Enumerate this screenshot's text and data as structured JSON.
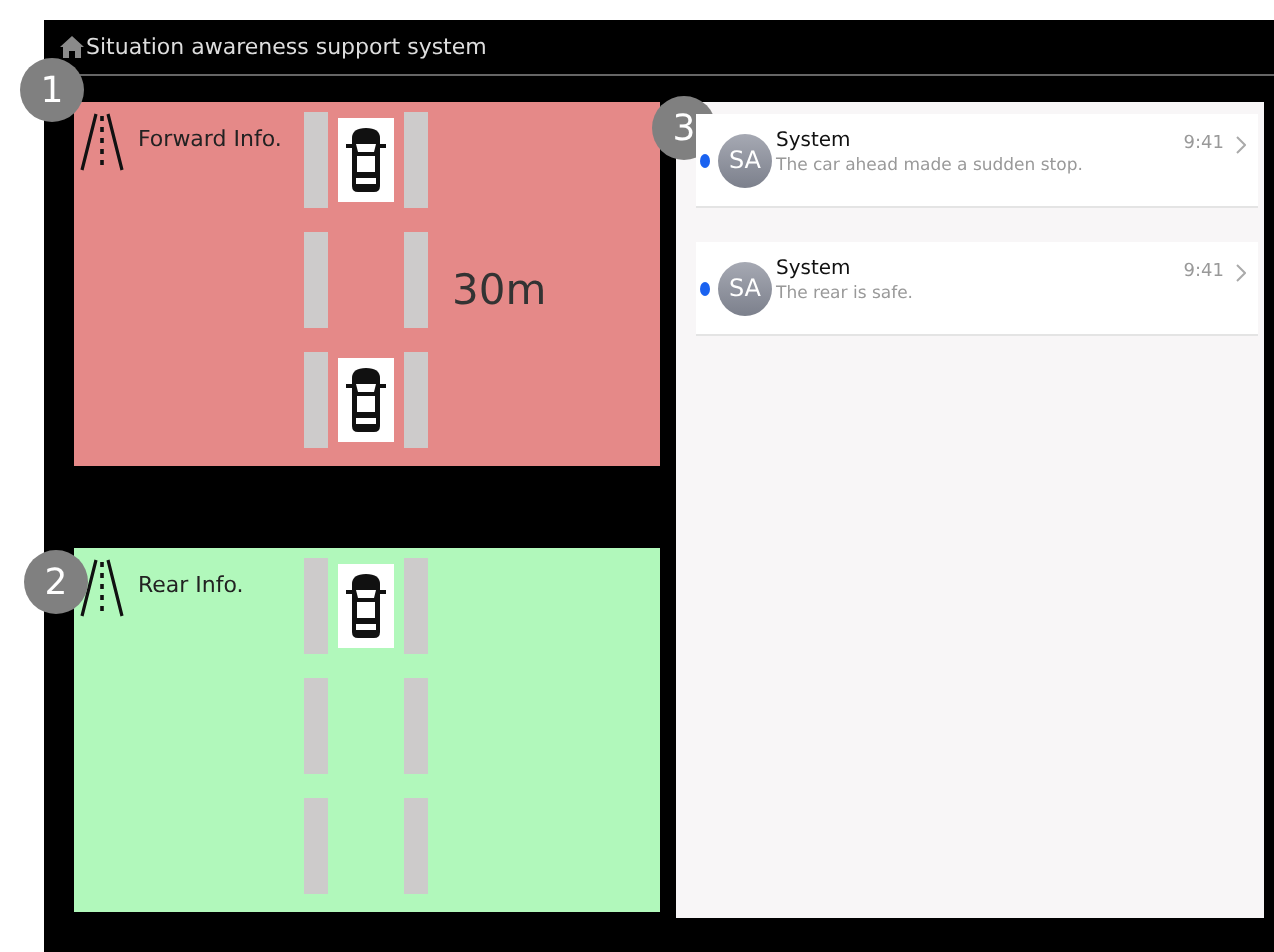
{
  "window": {
    "title": "Situation awareness support system"
  },
  "panels": [
    {
      "marker": "1",
      "title": "Forward Info.",
      "alert": true,
      "distance": "30m",
      "slots": [
        {
          "car": true
        },
        {
          "car": false
        },
        {
          "car": true
        }
      ]
    },
    {
      "marker": "2",
      "title": "Rear Info.",
      "alert": false,
      "slots": [
        {
          "car": true
        },
        {
          "car": false
        },
        {
          "car": false
        }
      ]
    }
  ],
  "messages_panel": {
    "marker": "3",
    "items": [
      {
        "avatar": "SA",
        "sender": "System",
        "text": "The car ahead made a sudden stop.",
        "time": "9:41",
        "unread": true
      },
      {
        "avatar": "SA",
        "sender": "System",
        "text": "The rear is safe.",
        "time": "9:41",
        "unread": true
      }
    ]
  }
}
